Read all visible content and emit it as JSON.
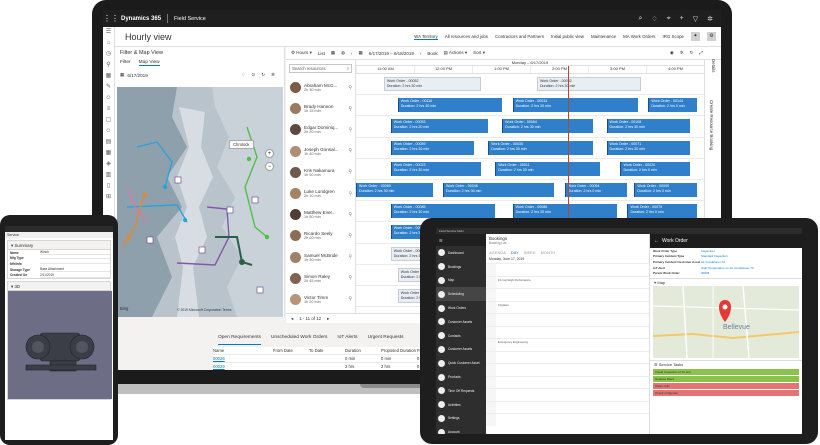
{
  "app": {
    "product": "Dynamics 365",
    "module": "Field Service",
    "page_title": "Hourly view",
    "view_tabs": [
      "WA Territory",
      "All resources and jobs",
      "Contractors and Partners",
      "Initial public view",
      "Maintenance",
      "MA Work Orders",
      "IRG Scope"
    ],
    "selected_tab_index": 0
  },
  "filter_map": {
    "title": "Filter & Map View",
    "tabs": [
      "Filter",
      "Map View"
    ],
    "selected_tab_index": 1,
    "date": "6/17/2019",
    "map_popup": "Chrolock",
    "map_attribution": "© 2019 Microsoft Corporation Terms",
    "bing_label": "Bing"
  },
  "schedule": {
    "toolbar": {
      "hours_label": "Hours",
      "list_label": "List",
      "date_range": "6/17/2019 – 6/18/2019",
      "book_label": "Book",
      "actions_label": "Actions",
      "sort_label": "Sort"
    },
    "search_placeholder": "Search resources",
    "date_header": "Monday – 6/17/2019",
    "hours": [
      "11:00 AM",
      "12:00 PM",
      "1:00 PM",
      "2:00 PM",
      "3:00 PM",
      "4:00 PM"
    ],
    "resources": [
      {
        "name": "Abraham McG...",
        "sub": "2h 30 min"
      },
      {
        "name": "Brady Hannon",
        "sub": "1h 15 min"
      },
      {
        "name": "Edgar Dominiq...",
        "sub": "2h 20 min"
      },
      {
        "name": "Joseph Gonsal...",
        "sub": "1h 40 min"
      },
      {
        "name": "Kris Nakamura",
        "sub": "1h 00 min"
      },
      {
        "name": "Luke Lundgren",
        "sub": "2h 10 min"
      },
      {
        "name": "Matthew Ever...",
        "sub": "1h 50 min"
      },
      {
        "name": "Ricardo Seely",
        "sub": "2h 00 min"
      },
      {
        "name": "Samuel McBride",
        "sub": "1h 30 min"
      },
      {
        "name": "Simon Raley",
        "sub": "2h 45 min"
      },
      {
        "name": "Victor Timm",
        "sub": "1h 20 min"
      }
    ],
    "bookings": [
      {
        "row": 0,
        "start": 0.08,
        "width": 0.28,
        "title": "Work Order - 00052",
        "dur": "Duration: 2 hrs 30 min",
        "light": true
      },
      {
        "row": 0,
        "start": 0.52,
        "width": 0.3,
        "title": "Work Order - 00032",
        "dur": "Duration: 2 hrs 30 min",
        "light": true
      },
      {
        "row": 1,
        "start": 0.12,
        "width": 0.3,
        "title": "Work Order - 00116",
        "dur": "Duration: 2 hrs 30 min",
        "light": false
      },
      {
        "row": 1,
        "start": 0.45,
        "width": 0.36,
        "title": "Work Order - 00034",
        "dur": "Duration: 2 hrs 30 min",
        "light": false
      },
      {
        "row": 1,
        "start": 0.84,
        "width": 0.14,
        "title": "Work Order - 00144",
        "dur": "Duration: 2 hrs 0 min",
        "light": false
      },
      {
        "row": 2,
        "start": 0.1,
        "width": 0.28,
        "title": "Work Order - 00053",
        "dur": "Duration: 2 hrs 20 min",
        "light": false
      },
      {
        "row": 2,
        "start": 0.42,
        "width": 0.26,
        "title": "Work Order - 00064",
        "dur": "Duration: 2 hrs 30 min",
        "light": false
      },
      {
        "row": 2,
        "start": 0.72,
        "width": 0.24,
        "title": "Work Order - 00108",
        "dur": "Duration: 2 hrs 30 min",
        "light": false
      },
      {
        "row": 3,
        "start": 0.1,
        "width": 0.24,
        "title": "Work Order - 00059",
        "dur": "Duration: 2 hrs 30 min",
        "light": false
      },
      {
        "row": 3,
        "start": 0.38,
        "width": 0.3,
        "title": "Work Order - 00035",
        "dur": "Duration: 2 hrs 30 min",
        "light": false
      },
      {
        "row": 3,
        "start": 0.72,
        "width": 0.24,
        "title": "Work Order - 00071",
        "dur": "Duration: 2 hrs 30 min",
        "light": false
      },
      {
        "row": 4,
        "start": 0.1,
        "width": 0.26,
        "title": "Work Order - 00023",
        "dur": "Duration: 2 hrs 30 min",
        "light": false
      },
      {
        "row": 4,
        "start": 0.4,
        "width": 0.3,
        "title": "Work Order - 00011",
        "dur": "Duration: 2 hrs 30 min",
        "light": false
      },
      {
        "row": 4,
        "start": 0.76,
        "width": 0.2,
        "title": "Work Order - 00020",
        "dur": "Duration: 2 hrs 0 min",
        "light": false
      },
      {
        "row": 5,
        "start": 0.0,
        "width": 0.22,
        "title": "Work Order - 00069",
        "dur": "Duration: 2 hrs 30 min",
        "light": false
      },
      {
        "row": 5,
        "start": 0.25,
        "width": 0.32,
        "title": "Work Order - 00046",
        "dur": "Duration: 2 hrs 30 min",
        "light": false
      },
      {
        "row": 5,
        "start": 0.6,
        "width": 0.18,
        "title": "Work Order - 00054",
        "dur": "Duration: 2 hrs 0 min",
        "light": false
      },
      {
        "row": 5,
        "start": 0.8,
        "width": 0.18,
        "title": "Work Order - 00090",
        "dur": "Duration: 2 hrs 0 min",
        "light": false
      },
      {
        "row": 6,
        "start": 0.1,
        "width": 0.3,
        "title": "Work Order - 00085",
        "dur": "Duration: 2 hrs 30 min",
        "light": false
      },
      {
        "row": 6,
        "start": 0.45,
        "width": 0.3,
        "title": "Work Order - 00086",
        "dur": "Duration: 2 hrs 30 min",
        "light": false
      },
      {
        "row": 6,
        "start": 0.78,
        "width": 0.2,
        "title": "Work Order - 00079",
        "dur": "Duration: 2 hrs 0 min",
        "light": false
      },
      {
        "row": 7,
        "start": 0.1,
        "width": 0.24,
        "title": "Work Order - 00040",
        "dur": "Duration: 2 hrs 30 min",
        "light": false
      },
      {
        "row": 7,
        "start": 0.42,
        "width": 0.28,
        "title": "Work Order - 00119",
        "dur": "Duration: 2 hrs 30 min",
        "light": false
      },
      {
        "row": 8,
        "start": 0.1,
        "width": 0.26,
        "title": "Work Order - 00075",
        "dur": "Duration: 2 hrs 30 min",
        "light": true
      },
      {
        "row": 9,
        "start": 0.12,
        "width": 0.28,
        "title": "Work Order - 00083",
        "dur": "Duration: 2 hrs 30 min",
        "light": true
      },
      {
        "row": 10,
        "start": 0.12,
        "width": 0.28,
        "title": "Work Order - 00084",
        "dur": "Duration: 2 hrs 30 min",
        "light": true
      }
    ],
    "pager": "1 - 11 of 12",
    "create_booking_label": "Create Resource Booking",
    "details_label": "Details"
  },
  "requirements": {
    "tabs": [
      "Open Requirements",
      "Unscheduled Work Orders",
      "IoT Alerts",
      "Urgent Requests"
    ],
    "selected_tab_index": 0,
    "columns": [
      "Name",
      "From Date",
      "To Date",
      "Duration",
      "Proposed Duration",
      "Fulfilled Duration",
      "Remaining Duration"
    ],
    "rows": [
      [
        "00026",
        "",
        "",
        "0 min",
        "0 min",
        "0 min",
        "0 min"
      ],
      [
        "00029",
        "",
        "",
        "2 hrs",
        "2 hrs",
        "0 min",
        "2 hrs"
      ]
    ]
  },
  "tablet_left": {
    "title": "Service",
    "summary_title": "Summary",
    "fields": [
      {
        "label": "Name",
        "value": "Winch"
      },
      {
        "label": "Mfg Type",
        "value": ""
      },
      {
        "label": "Mfr/Info",
        "value": ""
      },
      {
        "label": "Storage Type",
        "value": "Base Attachment"
      },
      {
        "label": "Created On",
        "value": "2/11/2019"
      }
    ],
    "viewer_title": "3D"
  },
  "tablet_right": {
    "app_title": "Field Service Mobi",
    "nav_items": [
      "Dashboard",
      "Bookings",
      "Map",
      "Scheduling",
      "Work Orders",
      "Customer Assets",
      "Contacts",
      "Customer Assets",
      "Quick Customer Asset",
      "Products",
      "Time Off Requests",
      "Activities",
      "Settings",
      "Account"
    ],
    "selected_nav_index": 3,
    "calendar": {
      "title": "Bookings",
      "subtitle": "Booking List",
      "views": [
        "AGENDA",
        "DAY",
        "WEEK",
        "MONTH"
      ],
      "selected_view_index": 1,
      "day": "Monday, June 17, 2019",
      "events": [
        "",
        "Fix Cell High Performance",
        "",
        "Irrigation",
        "",
        "",
        "Emergency Engineering",
        "",
        "",
        "",
        "",
        "",
        ""
      ]
    },
    "work_order": {
      "title": "Work Order",
      "fields": [
        {
          "label": "Work Order Type",
          "value": "Inspection"
        },
        {
          "label": "Primary Incident Type",
          "value": "Standard Inspection"
        },
        {
          "label": "Primary Incident Customer Asset",
          "value": "Air Conditioner 72"
        },
        {
          "label": "IoT Alert",
          "value": "High Temperature on Air Conditioner 72"
        },
        {
          "label": "Parent Work Order",
          "value": "00026"
        }
      ],
      "map_title": "Map",
      "map_city": "Bellevue",
      "tasks_title": "Service Tasks",
      "tasks": [
        {
          "label": "Visual inspection of 72 unit",
          "color": "#8bc34a"
        },
        {
          "label": "Replace filters",
          "color": "#8bc34a"
        },
        {
          "label": "Clean coils",
          "color": "#e57373"
        },
        {
          "label": "Check refrigerant",
          "color": "#e57373"
        }
      ]
    }
  },
  "colors": {
    "booking_blue": "#2f7fca",
    "accent": "#0078d4",
    "now_line": "#b7472a"
  }
}
